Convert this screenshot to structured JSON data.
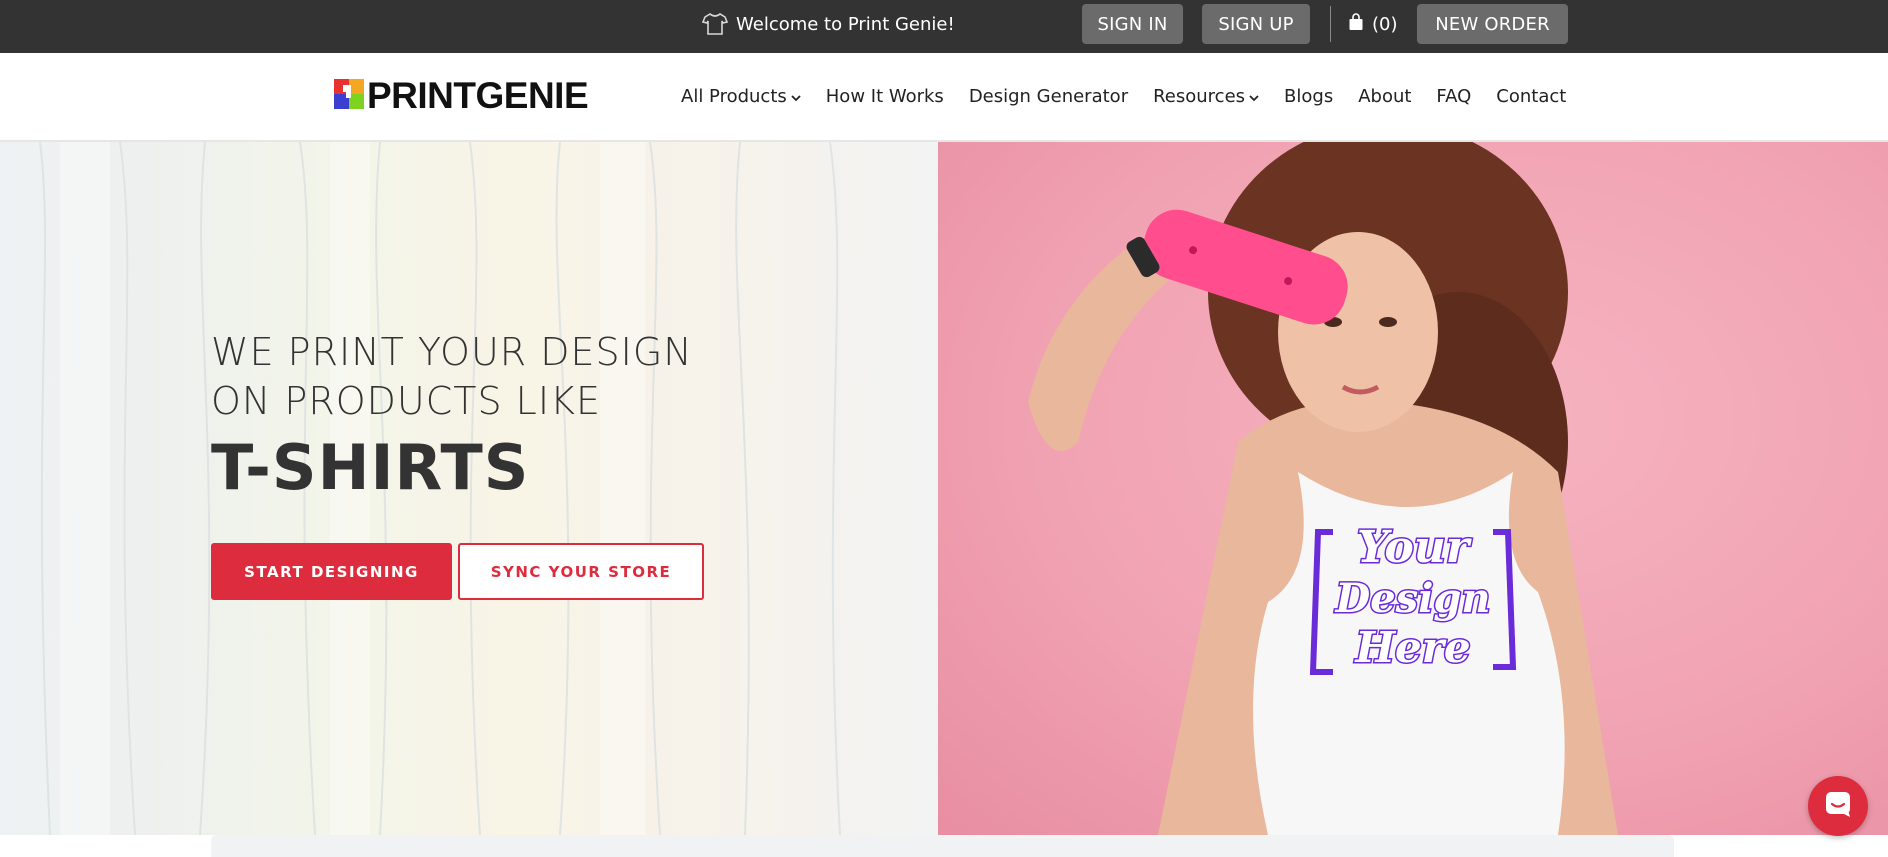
{
  "topbar": {
    "welcome_text": "Welcome to Print Genie!",
    "sign_in": "SIGN IN",
    "sign_up": "SIGN UP",
    "cart_count": "(0)",
    "new_order": "NEW ORDER"
  },
  "logo": {
    "text": "PRINTGENIE"
  },
  "nav": {
    "items": [
      {
        "label": "All Products",
        "has_dropdown": true
      },
      {
        "label": "How It Works",
        "has_dropdown": false
      },
      {
        "label": "Design Generator",
        "has_dropdown": false
      },
      {
        "label": "Resources",
        "has_dropdown": true
      },
      {
        "label": "Blogs",
        "has_dropdown": false
      },
      {
        "label": "About",
        "has_dropdown": false
      },
      {
        "label": "FAQ",
        "has_dropdown": false
      },
      {
        "label": "Contact",
        "has_dropdown": false
      }
    ]
  },
  "hero": {
    "line1": "WE PRINT YOUR DESIGN",
    "line2": "ON PRODUCTS LIKE",
    "product": "T-SHIRTS",
    "cta_primary": "START DESIGNING",
    "cta_secondary": "SYNC YOUR STORE",
    "shirt_print": [
      "Your",
      "Design",
      "Here"
    ]
  },
  "colors": {
    "accent": "#dc2c3e",
    "topbar_bg": "#333333",
    "topbar_button": "#6b6b6b",
    "hero_pink": "#f1a3b3",
    "print_purple": "#6a2bd9"
  },
  "icons": {
    "welcome": "tshirt-icon",
    "cart": "shopping-bag-icon",
    "dropdown": "chevron-down-icon",
    "chat": "chat-bubble-icon"
  }
}
